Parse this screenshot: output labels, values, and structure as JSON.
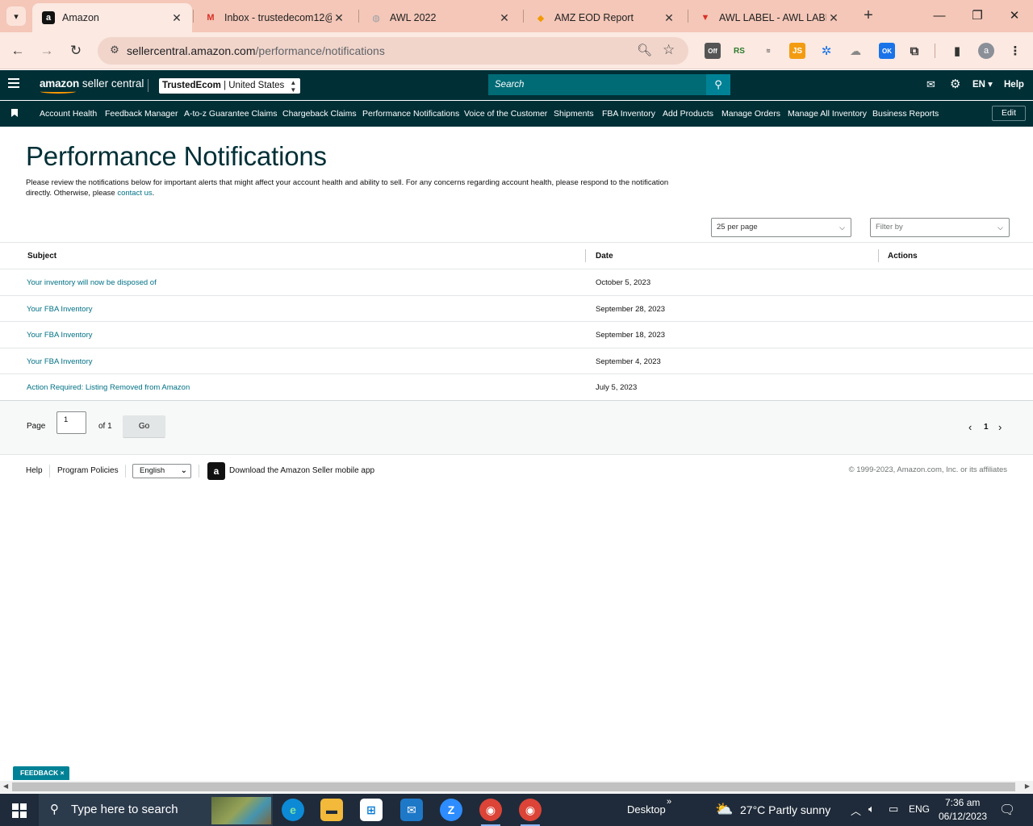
{
  "browser": {
    "tabs": [
      {
        "title": "Amazon",
        "favicon": "a",
        "favicon_bg": "#111111",
        "favicon_fg": "#ffffff",
        "active": true
      },
      {
        "title": "Inbox - trustedecom12@",
        "favicon": "M",
        "favicon_bg": "transparent",
        "favicon_fg": "#d93025",
        "active": false
      },
      {
        "title": "AWL 2022",
        "favicon": "◍",
        "favicon_bg": "transparent",
        "favicon_fg": "#9aa0a6",
        "active": false
      },
      {
        "title": "AMZ EOD Report",
        "favicon": "◆",
        "favicon_bg": "transparent",
        "favicon_fg": "#f29900",
        "active": false
      },
      {
        "title": "AWL LABEL - AWL LABEL",
        "favicon": "▼",
        "favicon_bg": "transparent",
        "favicon_fg": "#d93025",
        "active": false
      }
    ],
    "url_host": "sellercentral.amazon.com",
    "url_path": "/performance/notifications"
  },
  "header": {
    "logo_main": "amazon",
    "logo_sub": "seller central",
    "account_name": "TrustedEcom",
    "account_region": "| United States",
    "search_placeholder": "Search",
    "language": "EN",
    "help": "Help"
  },
  "nav": {
    "items": [
      "Account Health",
      "Feedback Manager",
      "A-to-z Guarantee Claims",
      "Chargeback Claims",
      "Performance Notifications",
      "Voice of the Customer",
      "Shipments",
      "FBA Inventory",
      "Add Products",
      "Manage Orders",
      "Manage All Inventory",
      "Business Reports"
    ],
    "edit": "Edit"
  },
  "main": {
    "title": "Performance Notifications",
    "intro_text": "Please review the notifications below for important alerts that might affect your account health and ability to sell. For any concerns regarding account health, please respond to the notification directly. Otherwise, please",
    "intro_link": "contact us",
    "intro_end": ".",
    "per_page": "25 per page",
    "filter_placeholder": "Filter by",
    "columns": {
      "subject": "Subject",
      "date": "Date",
      "actions": "Actions"
    },
    "rows": [
      {
        "subject": "Your inventory will now be disposed of",
        "date": "October 5, 2023"
      },
      {
        "subject": "Your FBA Inventory",
        "date": "September 28, 2023"
      },
      {
        "subject": "Your FBA Inventory",
        "date": "September 18, 2023"
      },
      {
        "subject": "Your FBA Inventory",
        "date": "September 4, 2023"
      },
      {
        "subject": "Action Required: Listing Removed from Amazon",
        "date": "July 5, 2023"
      }
    ],
    "pager": {
      "page_label": "Page",
      "page_value": "1",
      "of_label": "of 1",
      "go": "Go",
      "current": "1"
    }
  },
  "footer": {
    "help": "Help",
    "policies": "Program Policies",
    "language": "English",
    "app_text": "Download the Amazon Seller mobile app",
    "copyright": "© 1999-2023, Amazon.com, Inc. or its affiliates"
  },
  "feedback": "FEEDBACK ×",
  "taskbar": {
    "search_placeholder": "Type here to search",
    "desktop": "Desktop",
    "weather": "27°C  Partly sunny",
    "lang": "ENG",
    "time": "7:36 am",
    "date": "06/12/2023"
  },
  "colors": {
    "header_bg": "#002f36",
    "link": "#007185",
    "search_bg": "#006b75",
    "accent": "#008296"
  }
}
